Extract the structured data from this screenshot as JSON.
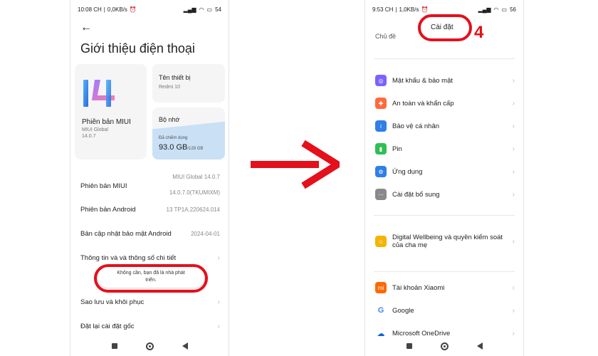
{
  "left_phone": {
    "status": {
      "time": "10:08 CH",
      "speed": "0,0KB/s",
      "battery": "54"
    },
    "title": "Giới thiệu điện thoại",
    "miui_card": {
      "title": "Phiên bản MIUI",
      "line1": "MIUI Global",
      "line2": "14.0.7"
    },
    "device_card": {
      "title": "Tên thiết bị",
      "value": "Redmi 10"
    },
    "storage_card": {
      "title": "Bộ nhớ",
      "used_label": "Đã chiếm dụng",
      "used": "93.0 GB",
      "total": "/128 GB",
      "used_fraction": 0.73
    },
    "rows": [
      {
        "label": "Phiên bản MIUI",
        "value1": "MIUI Global 14.0.7",
        "value2": "14.0.7.0(TKUMIXM)"
      },
      {
        "label": "Phiên bản Android",
        "value": "13 TP1A.220624.014"
      },
      {
        "label": "Bản cập nhật bảo mật Android",
        "value": "2024-04-01"
      },
      {
        "label": "Thông tin và và thông số chi tiết"
      },
      {
        "label": "Sao lưu và khôi phục"
      },
      {
        "label": "Đặt lại cài đặt gốc"
      }
    ],
    "toast": {
      "line1": "Không cần, bạn đã là nhà phát",
      "line2": "triển."
    }
  },
  "right_phone": {
    "status": {
      "time": "9:53 CH",
      "speed": "1,0KB/s",
      "battery": "56"
    },
    "header_title": "Cài đặt",
    "partial_item": "Chủ đề",
    "annotation_number": "4",
    "group1": [
      {
        "label": "Mật khẩu & bảo mật",
        "icon": "lock-icon",
        "color": "#7b61ff",
        "glyph": "◎"
      },
      {
        "label": "An toàn và khẩn cấp",
        "icon": "emergency-icon",
        "color": "#ff6b3d",
        "glyph": "✚"
      },
      {
        "label": "Bảo vệ cá nhân",
        "icon": "privacy-icon",
        "color": "#2f7fe8",
        "glyph": "i"
      },
      {
        "label": "Pin",
        "icon": "battery-icon",
        "color": "#2fbf55",
        "glyph": "▮"
      },
      {
        "label": "Ứng dụng",
        "icon": "apps-icon",
        "color": "#2f7fe8",
        "glyph": "⚙"
      },
      {
        "label": "Cài đặt bổ sung",
        "icon": "more-icon",
        "color": "#8a8a8a",
        "glyph": "⋯"
      }
    ],
    "group2": [
      {
        "label": "Digital Wellbeing và quyền kiểm soát của cha mẹ",
        "icon": "wellbeing-icon",
        "color": "#f5b400",
        "glyph": "☺"
      }
    ],
    "group3": [
      {
        "label": "Tài khoản Xiaomi",
        "icon": "xiaomi-icon",
        "color": "#ff6900",
        "glyph": "mi"
      },
      {
        "label": "Google",
        "icon": "google-icon",
        "color": "#ffffff",
        "glyph": "G"
      },
      {
        "label": "Microsoft OneDrive",
        "icon": "onedrive-icon",
        "color": "#ffffff",
        "glyph": "☁"
      }
    ]
  }
}
